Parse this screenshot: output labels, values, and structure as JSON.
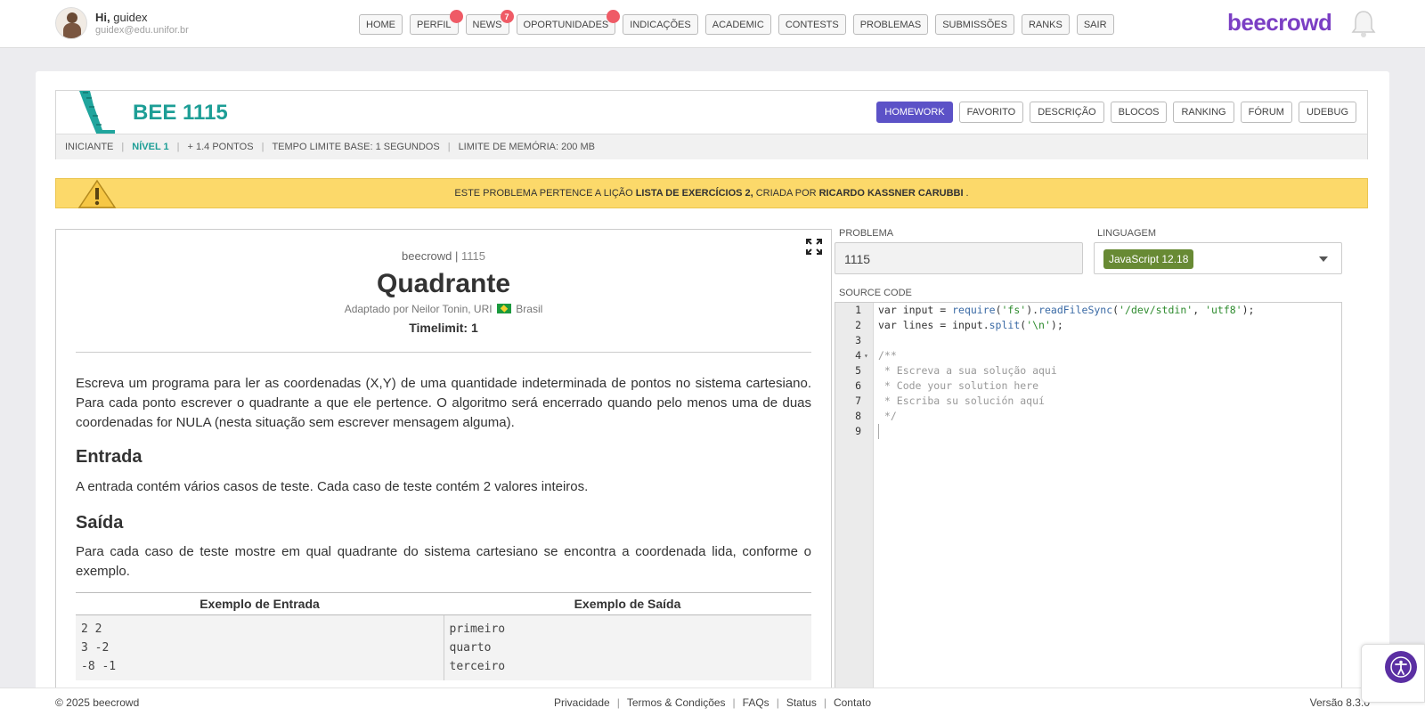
{
  "user": {
    "greeting_prefix": "Hi,",
    "name": "guidex",
    "email": "guidex@edu.unifor.br"
  },
  "nav": [
    {
      "label": "HOME",
      "badge": ""
    },
    {
      "label": "PERFIL",
      "badge": "dot"
    },
    {
      "label": "NEWS",
      "badge": "7"
    },
    {
      "label": "OPORTUNIDADES",
      "badge": "dot"
    },
    {
      "label": "INDICAÇÕES",
      "badge": ""
    },
    {
      "label": "ACADEMIC",
      "badge": ""
    },
    {
      "label": "CONTESTS",
      "badge": ""
    },
    {
      "label": "PROBLEMAS",
      "badge": ""
    },
    {
      "label": "SUBMISSÕES",
      "badge": ""
    },
    {
      "label": "RANKS",
      "badge": ""
    },
    {
      "label": "SAIR",
      "badge": ""
    }
  ],
  "brand": {
    "logo": "beecrowd",
    "logo_color": "#7b3fc4"
  },
  "problem": {
    "title": "BEE 1115",
    "tabs": [
      "HOMEWORK",
      "FAVORITO",
      "DESCRIÇÃO",
      "BLOCOS",
      "RANKING",
      "FÓRUM",
      "UDEBUG"
    ],
    "active_tab": "HOMEWORK",
    "meta": {
      "category": "INICIANTE",
      "level": "NÍVEL 1",
      "points": "+ 1.4 PONTOS",
      "time": "TEMPO LIMITE BASE: 1 SEGUNDOS",
      "memory": "LIMITE DE MEMÓRIA: 200 MB"
    }
  },
  "notice": {
    "prefix": "ESTE PROBLEMA PERTENCE A LIÇÃO",
    "lesson": "LISTA DE EXERCÍCIOS 2,",
    "middle": "CRIADA POR",
    "author": "RICARDO KASSNER CARUBBI",
    "suffix": "."
  },
  "statement": {
    "brand": "beecrowd |",
    "number": "1115",
    "title": "Quadrante",
    "author_prefix": "Adaptado por Neilor Tonin, URI",
    "country": "Brasil",
    "timelimit": "Timelimit: 1",
    "description": "Escreva um programa para ler as coordenadas (X,Y) de uma quantidade indeterminada de pontos no sistema cartesiano. Para cada ponto escrever o quadrante a que ele pertence. O algoritmo será encerrado quando pelo menos uma de duas coordenadas for NULA (nesta situação sem escrever mensagem alguma).",
    "input_title": "Entrada",
    "input_text": "A entrada contém vários casos de teste. Cada caso de teste contém 2 valores inteiros.",
    "output_title": "Saída",
    "output_text": "Para cada caso de teste mostre em qual quadrante do sistema cartesiano se encontra a coordenada lida, conforme o exemplo.",
    "example": {
      "input_header": "Exemplo de Entrada",
      "output_header": "Exemplo de Saída",
      "input_lines": [
        "2 2",
        "3 -2",
        "-8 -1"
      ],
      "output_lines": [
        "primeiro",
        "quarto",
        "terceiro"
      ]
    }
  },
  "form": {
    "problem_label": "PROBLEMA",
    "problem_value": "1115",
    "language_label": "LINGUAGEM",
    "language_value": "JavaScript 12.18",
    "source_label": "SOURCE CODE"
  },
  "code_lines": [
    "var input = require('fs').readFileSync('/dev/stdin', 'utf8');",
    "var lines = input.split('\\n');",
    "",
    "/**",
    " * Escreva a sua solução aqui",
    " * Code your solution here",
    " * Escriba su solución aquí",
    " */",
    ""
  ],
  "footer": {
    "copyright": "© 2025 beecrowd",
    "links": [
      "Privacidade",
      "Termos & Condições",
      "FAQs",
      "Status",
      "Contato"
    ],
    "version": "Versão 8.3.0"
  },
  "colors": {
    "accent": "#5c52c7",
    "teal": "#1d9e96",
    "notice": "#fcd96a",
    "badge": "#ef5b66",
    "js_badge": "#688a34"
  }
}
